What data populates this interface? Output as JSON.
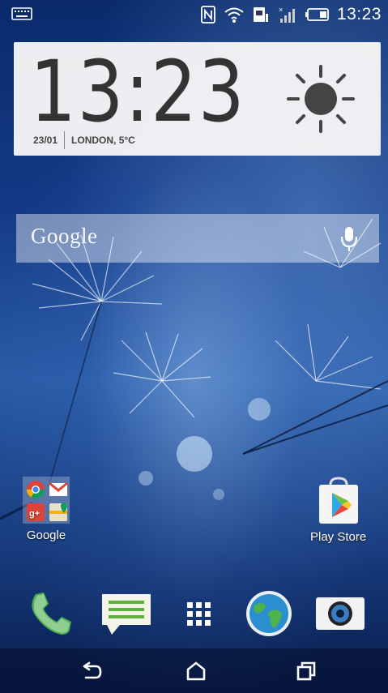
{
  "status_bar": {
    "time": "13:23",
    "icons": [
      "keyboard-icon",
      "nfc-icon",
      "wifi-icon",
      "sim-icon",
      "signal-icon",
      "battery-icon"
    ]
  },
  "clock_widget": {
    "time": "13:23",
    "date": "23/01",
    "location_weather": "LONDON, 5°C",
    "weather_icon": "sun-icon"
  },
  "search": {
    "label": "Google",
    "mic_icon": "mic-icon"
  },
  "home_apps": [
    {
      "label": "Google",
      "icon": "google-folder-icon"
    },
    {
      "label": "Play Store",
      "icon": "play-store-icon"
    }
  ],
  "dock": [
    {
      "name": "phone-icon"
    },
    {
      "name": "messages-icon"
    },
    {
      "name": "app-drawer-icon"
    },
    {
      "name": "browser-icon"
    },
    {
      "name": "camera-icon"
    }
  ],
  "navigation": [
    "back-icon",
    "home-icon",
    "recent-apps-icon"
  ],
  "colors": {
    "accent_green": "#4caf50",
    "widget_bg": "#f6f6f6"
  }
}
